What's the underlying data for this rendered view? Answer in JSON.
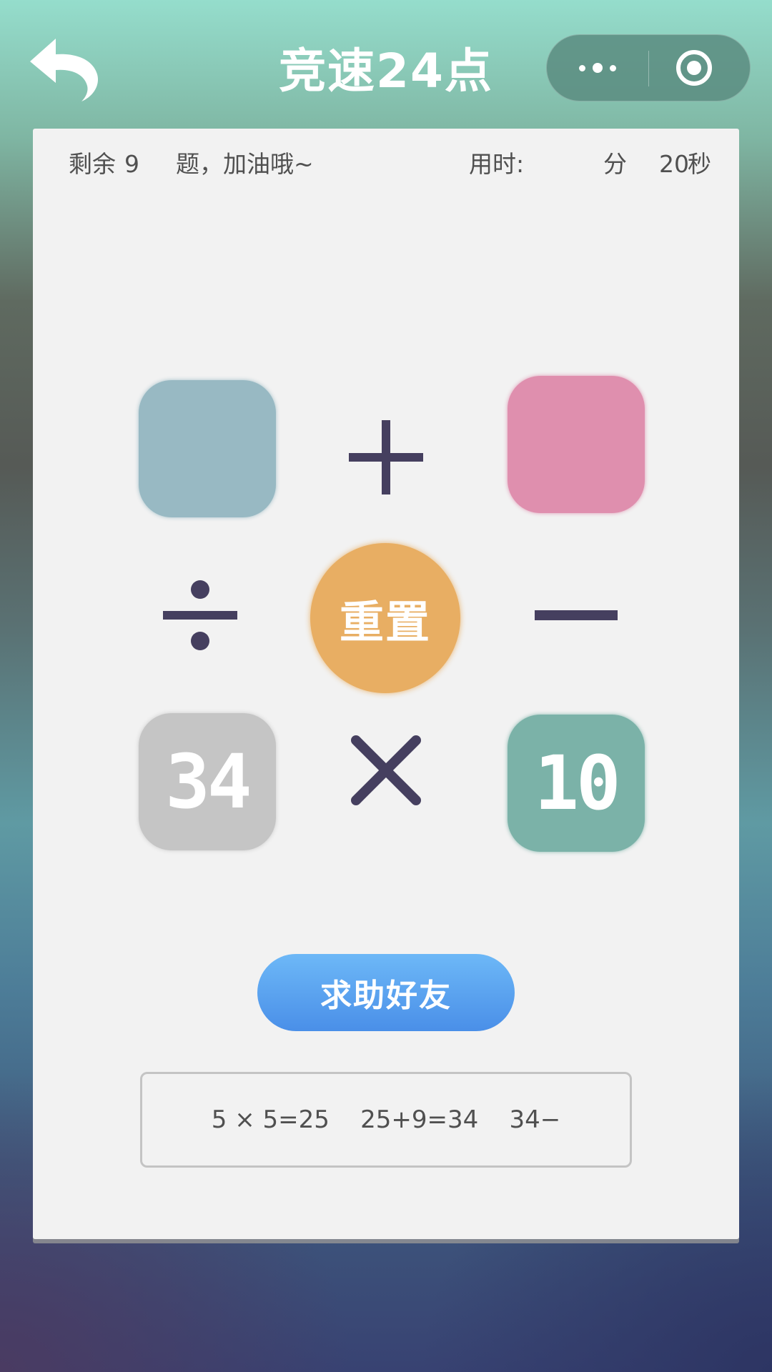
{
  "header": {
    "title": "竞速24点",
    "back_icon": "back-arrow-icon",
    "more_icon": "more-dots-icon",
    "close_icon": "target-circle-icon"
  },
  "status": {
    "remaining_prefix": "剩余",
    "remaining_count": "9",
    "remaining_suffix": "题，加油哦~",
    "time_label": "用时:",
    "minutes_unit": "分",
    "seconds_value": "20",
    "seconds_unit": "秒"
  },
  "board": {
    "tiles": [
      {
        "position": "top-left",
        "value": "",
        "color": "#98b9c3"
      },
      {
        "position": "top-right",
        "value": "",
        "color": "#df8fae"
      },
      {
        "position": "bottom-left",
        "value": "34",
        "color": "#c5c5c5"
      },
      {
        "position": "bottom-right",
        "value": "10",
        "color": "#7bb2a8"
      }
    ],
    "operators": [
      "plus-icon",
      "minus-icon",
      "times-icon",
      "divide-icon"
    ],
    "operator_color": "#453f5f",
    "reset_label": "重置",
    "reset_color": "#e8ae63"
  },
  "help_button": {
    "label": "求助好友"
  },
  "record": {
    "text": "5 × 5=25    25+9=34    34−"
  }
}
